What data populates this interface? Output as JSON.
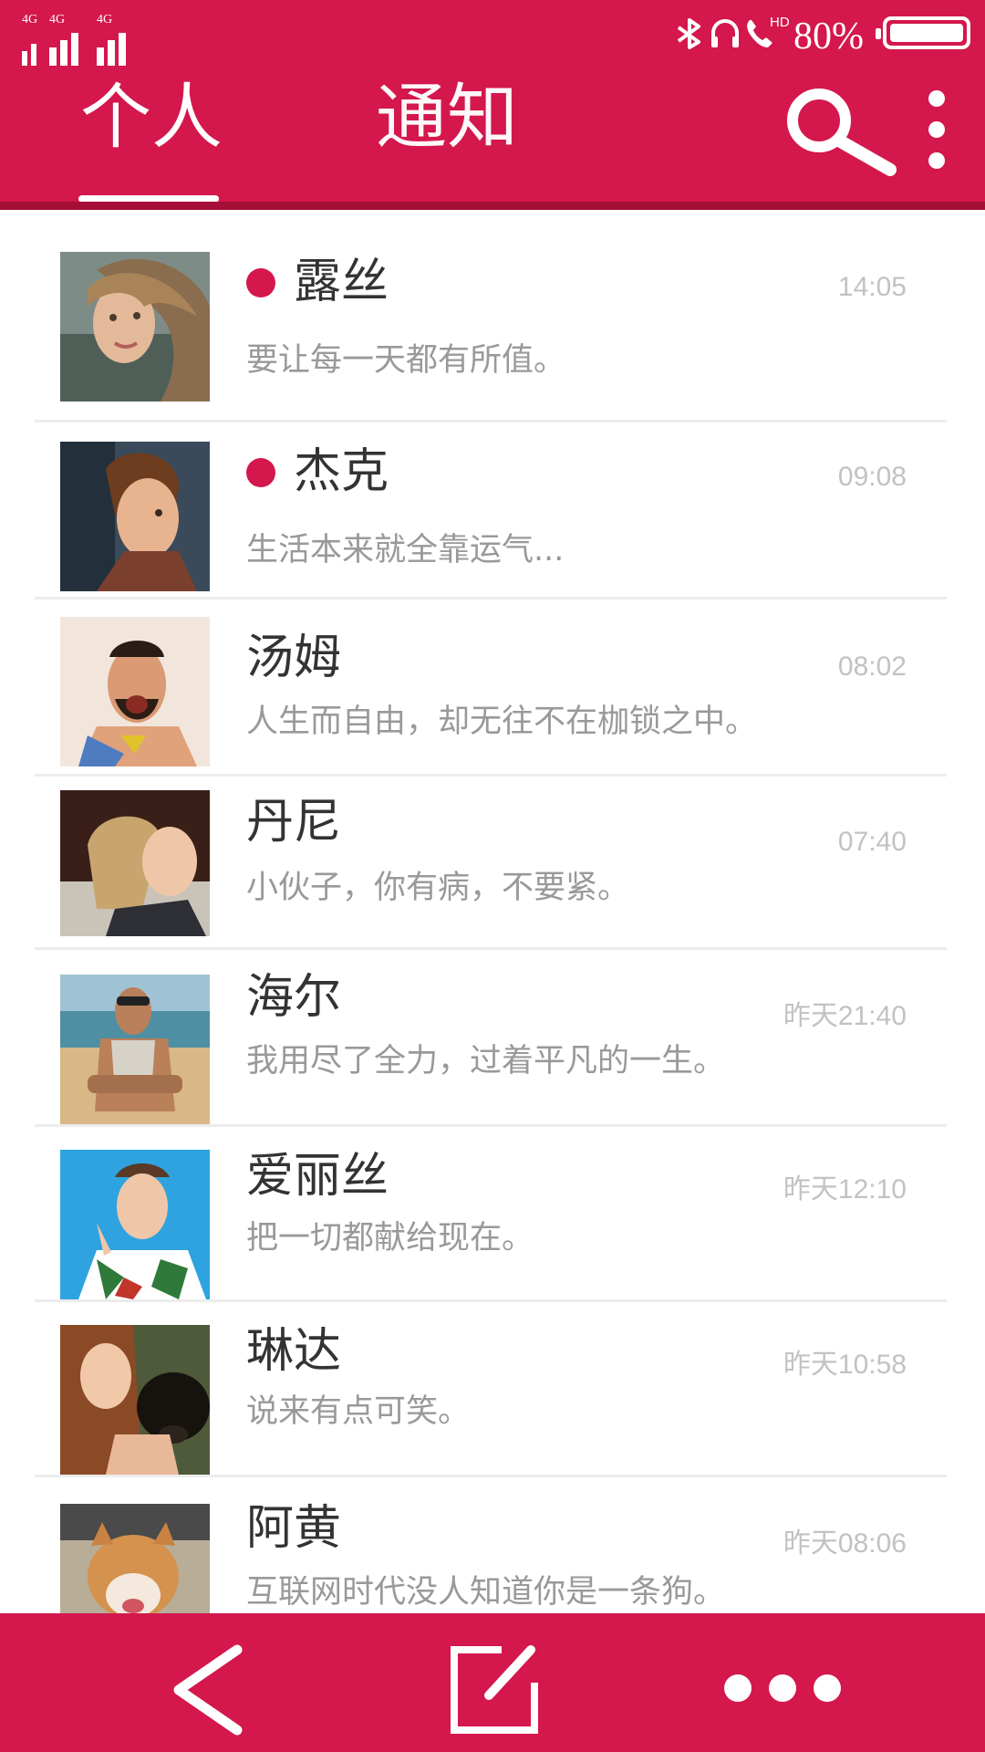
{
  "status_bar": {
    "signal_labels": [
      "4G",
      "4G",
      "4G"
    ],
    "battery_percent": "80%",
    "hd_label": "HD",
    "icons": [
      "bluetooth-icon",
      "headset-icon",
      "hd-call-icon",
      "battery-icon"
    ]
  },
  "header": {
    "tabs": [
      {
        "label": "个人",
        "active": true
      },
      {
        "label": "通知",
        "active": false
      }
    ],
    "icons": [
      "search-icon",
      "more-vertical-icon"
    ]
  },
  "conversations": [
    {
      "name": "露丝",
      "preview": "要让每一天都有所值。",
      "time": "14:05",
      "unread": true
    },
    {
      "name": "杰克",
      "preview": "生活本来就全靠运气...",
      "time": "09:08",
      "unread": true
    },
    {
      "name": "汤姆",
      "preview": "人生而自由，却无往不在枷锁之中。",
      "time": "08:02",
      "unread": false
    },
    {
      "name": "丹尼",
      "preview": "小伙子，你有病，不要紧。",
      "time": "07:40",
      "unread": false
    },
    {
      "name": "海尔",
      "preview": "我用尽了全力，过着平凡的一生。",
      "time": "昨天21:40",
      "unread": false
    },
    {
      "name": "爱丽丝",
      "preview": "把一切都献给现在。",
      "time": "昨天12:10",
      "unread": false
    },
    {
      "name": "琳达",
      "preview": "说来有点可笑。",
      "time": "昨天10:58",
      "unread": false
    },
    {
      "name": "阿黄",
      "preview": "互联网时代没人知道你是一条狗。",
      "time": "昨天08:06",
      "unread": false
    }
  ],
  "bottom_bar": {
    "icons": [
      "back-icon",
      "compose-icon",
      "more-horizontal-icon"
    ]
  },
  "colors": {
    "accent": "#d4174c",
    "accent_dark": "#a50e36",
    "name_text": "#333333",
    "preview_text": "#999999",
    "time_text": "#c2c2c2"
  }
}
